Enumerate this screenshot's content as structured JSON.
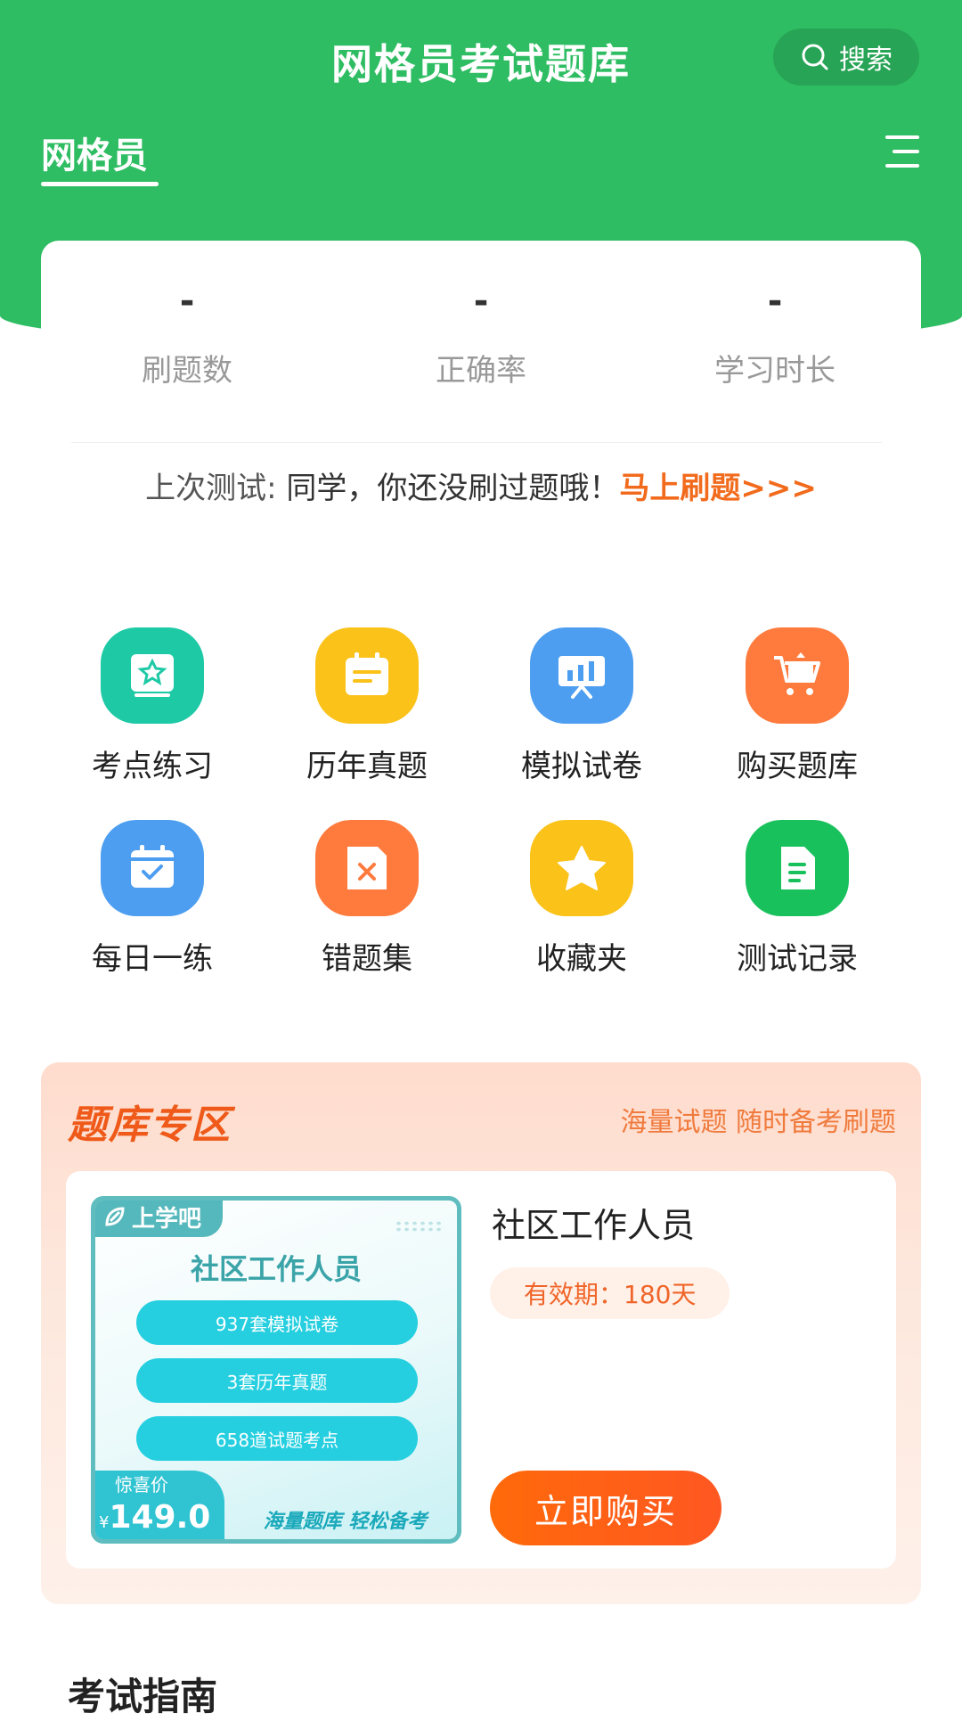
{
  "header": {
    "title": "网格员考试题库",
    "search_label": "搜索",
    "tab_active": "网格员"
  },
  "stats": [
    {
      "value": "-",
      "label": "刷题数"
    },
    {
      "value": "-",
      "label": "正确率"
    },
    {
      "value": "-",
      "label": "学习时长"
    }
  ],
  "last_test": {
    "label": "上次测试:",
    "message": " 同学，你还没刷过题哦！",
    "action": "马上刷题>>>"
  },
  "features": [
    {
      "label": "考点练习",
      "icon": "exam-point-icon",
      "color": "#1ec9a6"
    },
    {
      "label": "历年真题",
      "icon": "calendar-paper-icon",
      "color": "#fbc21a"
    },
    {
      "label": "模拟试卷",
      "icon": "chart-board-icon",
      "color": "#4d9ef0"
    },
    {
      "label": "购买题库",
      "icon": "cart-icon",
      "color": "#ff7a3d"
    },
    {
      "label": "每日一练",
      "icon": "calendar-check-icon",
      "color": "#4d9ef0"
    },
    {
      "label": "错题集",
      "icon": "wrong-book-icon",
      "color": "#ff7a3d"
    },
    {
      "label": "收藏夹",
      "icon": "star-icon",
      "color": "#fbc21a"
    },
    {
      "label": "测试记录",
      "icon": "record-doc-icon",
      "color": "#19c15c"
    }
  ],
  "zone": {
    "title": "题库专区",
    "slogan": "海量试题 随时备考刷题",
    "product": {
      "name": "社区工作人员",
      "validity": "有效期：180天",
      "buy_label": "立即购买",
      "cover": {
        "brand": "上学吧",
        "title": "社区工作人员",
        "pills": [
          "937套模拟试卷",
          "3套历年真题",
          "658道试题考点"
        ],
        "price_label": "惊喜价",
        "currency": "¥",
        "price": "149.0",
        "strip": "海量题库  轻松备考"
      }
    }
  },
  "guide": {
    "title": "考试指南"
  }
}
